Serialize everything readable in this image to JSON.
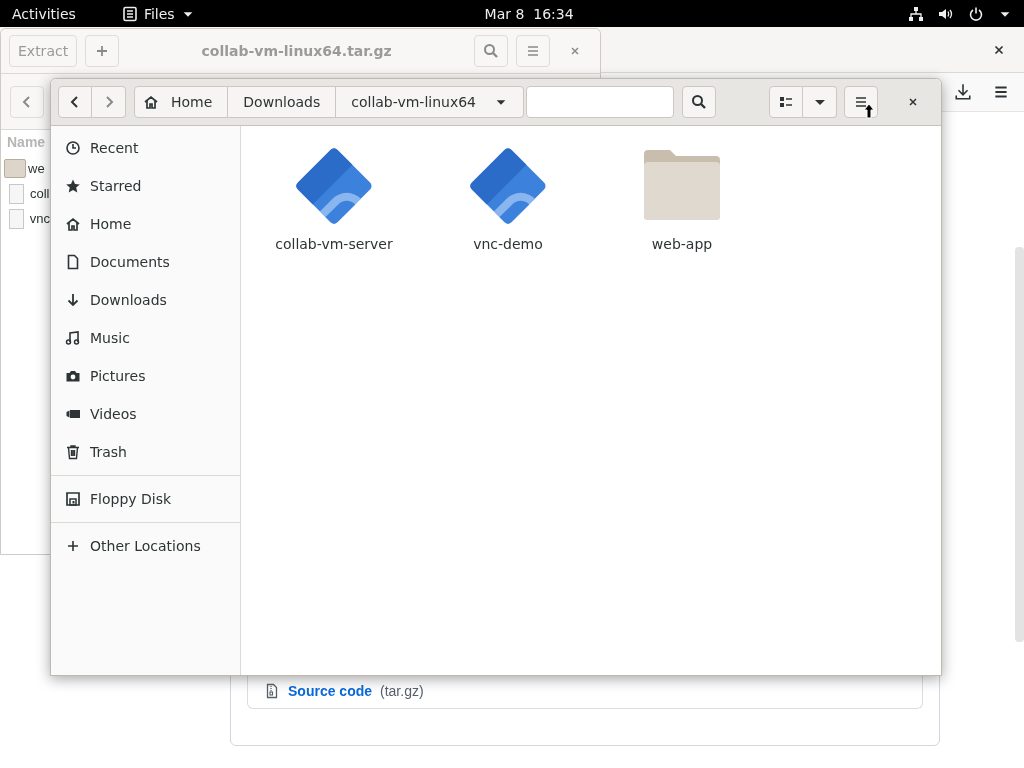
{
  "top_bar": {
    "activities": "Activities",
    "app_menu": "Files",
    "clock": "Mar 8  16:34"
  },
  "browser_window": {
    "asset": {
      "name": "Source code",
      "format": "(tar.gz)"
    }
  },
  "archive_window": {
    "extract_button": "Extract",
    "title": "collab-vm-linux64.tar.gz",
    "column_header": "Name",
    "rows": [
      {
        "kind": "folder",
        "name": "we"
      },
      {
        "kind": "file",
        "name": "coll"
      },
      {
        "kind": "file",
        "name": "vnc"
      }
    ]
  },
  "files_window": {
    "path": [
      {
        "kind": "home",
        "label": "Home"
      },
      {
        "kind": "folder",
        "label": "Downloads"
      },
      {
        "kind": "current",
        "label": "collab-vm-linux64"
      }
    ],
    "sidebar": [
      {
        "items": [
          {
            "kind": "recent",
            "label": "Recent"
          },
          {
            "kind": "starred",
            "label": "Starred"
          },
          {
            "kind": "home",
            "label": "Home"
          },
          {
            "kind": "documents",
            "label": "Documents"
          },
          {
            "kind": "downloads",
            "label": "Downloads"
          },
          {
            "kind": "music",
            "label": "Music"
          },
          {
            "kind": "pictures",
            "label": "Pictures"
          },
          {
            "kind": "videos",
            "label": "Videos"
          },
          {
            "kind": "trash",
            "label": "Trash"
          }
        ]
      },
      {
        "items": [
          {
            "kind": "floppy",
            "label": "Floppy Disk"
          }
        ]
      },
      {
        "items": [
          {
            "kind": "other",
            "label": "Other Locations"
          }
        ]
      }
    ],
    "files": [
      {
        "kind": "executable",
        "name": "collab-vm-server"
      },
      {
        "kind": "executable",
        "name": "vnc-demo"
      },
      {
        "kind": "folder",
        "name": "web-app"
      }
    ]
  }
}
